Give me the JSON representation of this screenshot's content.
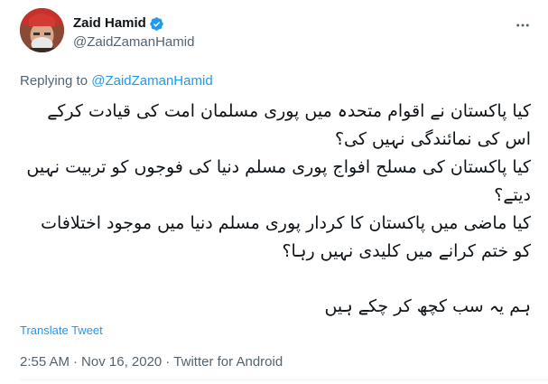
{
  "author": {
    "display_name": "Zaid Hamid",
    "handle": "@ZaidZamanHamid",
    "verified": true,
    "avatar_icon": "profile-photo"
  },
  "more_icon": "more-horizontal-icon",
  "reply": {
    "prefix": "Replying to",
    "mention": "@ZaidZamanHamid"
  },
  "body": {
    "line1": "کیا پاکستان نے اقوام متحدہ میں پوری مسلمان امت کی قیادت کرکے اس کی نمائندگی نہیں کی؟",
    "line2": "کیا پاکستان کی مسلح افواج پوری مسلم دنیا کی فوجوں کو تربیت نہیں دیتے؟",
    "line3": "کیا ماضی میں پاکستان کا کردار پوری مسلم دنیا میں موجود اختلافات کو ختم کرانے میں کلیدی نہیں رہا؟",
    "line4": "ہم یہ سب کچھ کر چکے ہیں"
  },
  "translate_label": "Translate Tweet",
  "meta": {
    "time": "2:55 AM",
    "date": "Nov 16, 2020",
    "source": "Twitter for Android",
    "separator": "·"
  },
  "colors": {
    "accent": "#1d9bf0",
    "secondary_text": "#536471",
    "primary_text": "#0f1419"
  }
}
